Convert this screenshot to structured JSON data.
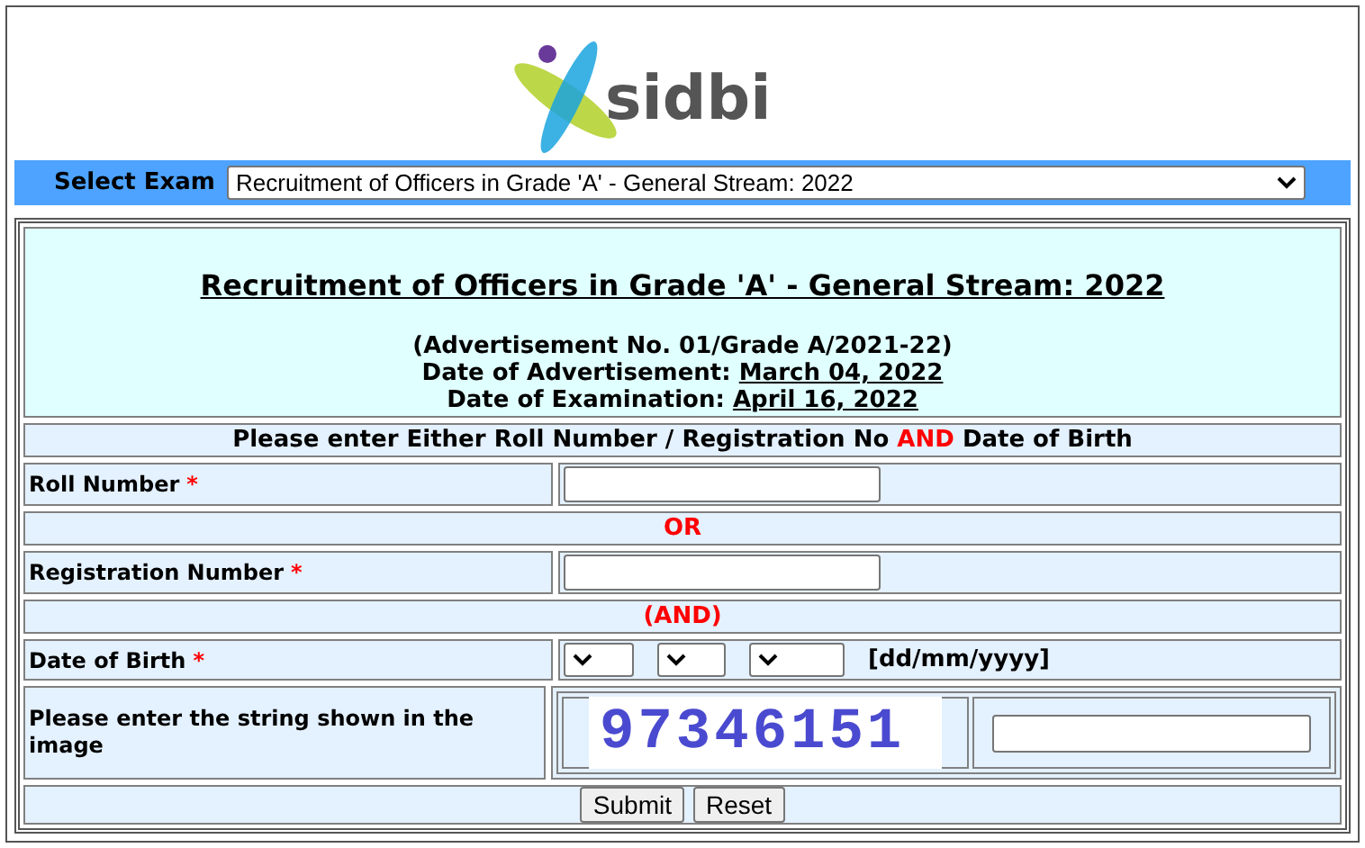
{
  "logo": {
    "text": "sidbi"
  },
  "exam_select": {
    "label": "Select Exam",
    "value": "Recruitment of Officers in Grade 'A' - General Stream: 2022"
  },
  "header": {
    "title": "Recruitment of Officers in Grade 'A' - General Stream: 2022",
    "advertisement_no": "(Advertisement No. 01/Grade A/2021-22)",
    "advertisement_date_label": "Date of Advertisement:",
    "advertisement_date": "March 04, 2022",
    "exam_date_label": "Date of Examination:",
    "exam_date": "April 16, 2022"
  },
  "instruction": {
    "before": "Please enter Either Roll Number / Registration No",
    "emphasis": "AND",
    "after": "Date of Birth"
  },
  "rows": [
    {
      "kind": "text",
      "label": "Roll Number",
      "required_mark": "*"
    },
    {
      "kind": "separator",
      "label": "OR"
    },
    {
      "kind": "text",
      "label": "Registration Number",
      "required_mark": "*"
    },
    {
      "kind": "separator",
      "label": "(AND)"
    },
    {
      "kind": "dob",
      "label": "Date of Birth",
      "required_mark": "*",
      "format": "[dd/mm/yyyy]"
    },
    {
      "kind": "captcha",
      "label": "Please enter the string shown in the image",
      "captcha": "97346151"
    }
  ],
  "buttons": [
    "Submit",
    "Reset"
  ]
}
